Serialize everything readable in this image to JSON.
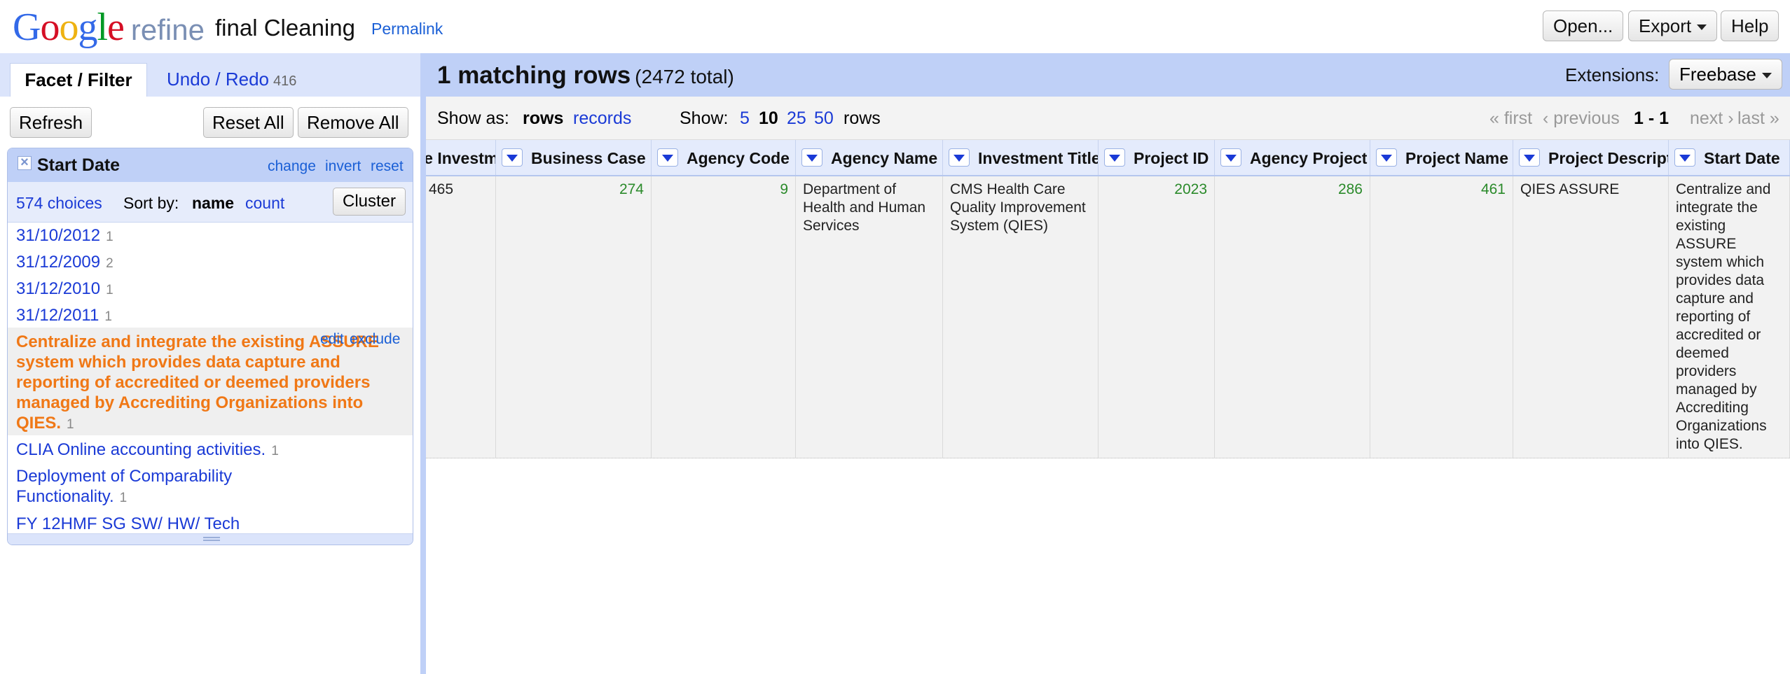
{
  "header": {
    "logo_google": "Google",
    "logo_refine": "refine",
    "project_name": "final Cleaning",
    "permalink": "Permalink",
    "open_label": "Open...",
    "export_label": "Export",
    "help_label": "Help",
    "logo_colors": [
      "#3369e8",
      "#d50f25",
      "#eeb211",
      "#3369e8",
      "#009925",
      "#d50f25"
    ]
  },
  "left_panel": {
    "tab_facet": "Facet / Filter",
    "tab_undo": "Undo / Redo",
    "undo_count": "416",
    "refresh_label": "Refresh",
    "reset_all_label": "Reset All",
    "remove_all_label": "Remove All",
    "facet": {
      "title": "Start Date",
      "change": "change",
      "invert": "invert",
      "reset": "reset",
      "choices_count": "574 choices",
      "sort_by_label": "Sort by:",
      "sort_name": "name",
      "sort_count": "count",
      "cluster_label": "Cluster",
      "edit_label": "edit",
      "exclude_label": "exclude",
      "choices": [
        {
          "name": "31/10/2012",
          "count": "1"
        },
        {
          "name": "31/12/2009",
          "count": "2"
        },
        {
          "name": "31/12/2010",
          "count": "1"
        },
        {
          "name": "31/12/2011",
          "count": "1"
        },
        {
          "name": "Centralize and integrate the existing ASSURE system which provides data capture and reporting of accredited or deemed providers managed by Accrediting Organizations into QIES.",
          "count": "1",
          "selected": true
        },
        {
          "name": "CLIA Online accounting activities.",
          "count": "1"
        },
        {
          "name": "Deployment of Comparability Functionality.",
          "count": "1"
        },
        {
          "name": "FY 12HMF SG SW/ HW/ Tech",
          "count": ""
        }
      ]
    }
  },
  "summary": {
    "matching": "1 matching rows",
    "total": "(2472 total)",
    "extensions_label": "Extensions:",
    "freebase_label": "Freebase"
  },
  "view_bar": {
    "show_as": "Show as:",
    "rows": "rows",
    "records": "records",
    "show": "Show:",
    "opt5": "5",
    "opt10": "10",
    "opt25": "25",
    "opt50": "50",
    "rows_suffix": "rows",
    "first": "« first",
    "previous": "‹ previous",
    "range": "1 - 1",
    "next": "next ›",
    "last": "last »"
  },
  "grid": {
    "columns": [
      "Unique Investment Identifier",
      "Business Case ID",
      "Agency Code",
      "Agency Name",
      "Investment Title",
      "Project ID",
      "Agency Project ID",
      "Project Name",
      "Project Description",
      "Start Date"
    ],
    "row": [
      "465",
      "274",
      "9",
      "Department of Health and Human Services",
      "CMS Health Care Quality Improvement System (QIES)",
      "2023",
      "286",
      "461",
      "QIES ASSURE",
      "Centralize and integrate the existing ASSURE system which provides data capture and reporting of accredited or deemed providers managed by Accrediting Organizations into QIES."
    ]
  }
}
